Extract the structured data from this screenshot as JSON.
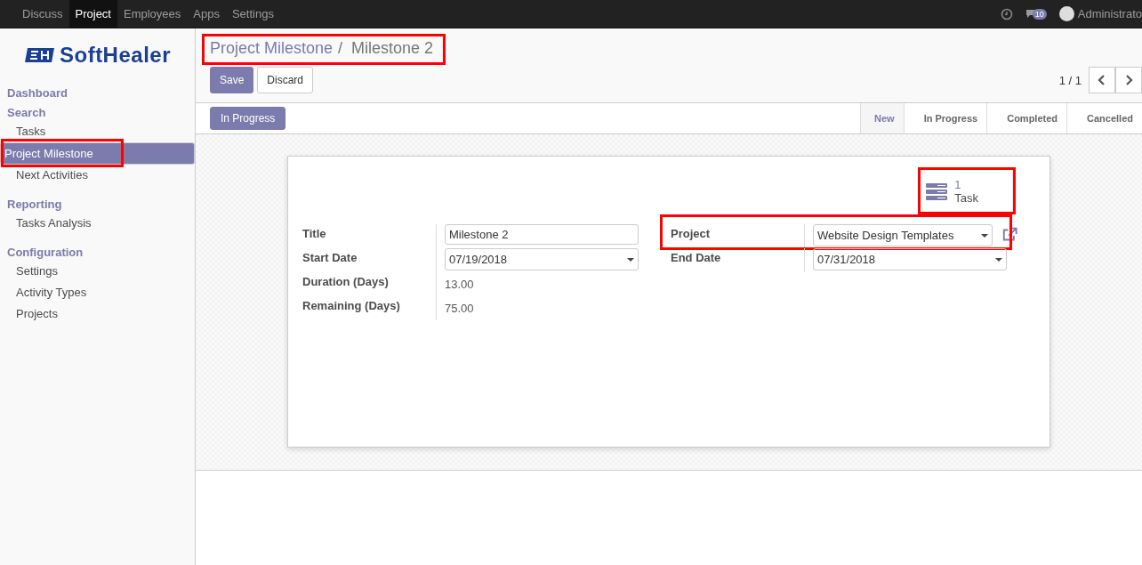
{
  "topbar": {
    "apps": [
      {
        "label": "Discuss",
        "selected": false
      },
      {
        "label": "Project",
        "selected": true
      },
      {
        "label": "Employees",
        "selected": false
      },
      {
        "label": "Apps",
        "selected": false
      },
      {
        "label": "Settings",
        "selected": false
      }
    ],
    "message_count": "10",
    "user": "Administrato"
  },
  "sidebar": {
    "logo": "SoftHealer",
    "sections": [
      {
        "title": "Dashboard"
      },
      {
        "title": "Search",
        "items": [
          {
            "label": "Tasks",
            "selected": false,
            "highlighted": false
          },
          {
            "label": "Project Milestone",
            "selected": true,
            "highlighted": true
          },
          {
            "label": "Next Activities",
            "selected": false,
            "highlighted": false
          }
        ]
      },
      {
        "title": "Reporting",
        "items": [
          {
            "label": "Tasks Analysis",
            "selected": false,
            "highlighted": false
          }
        ]
      },
      {
        "title": "Configuration",
        "items": [
          {
            "label": "Settings",
            "selected": false,
            "highlighted": false
          },
          {
            "label": "Activity Types",
            "selected": false,
            "highlighted": false
          },
          {
            "label": "Projects",
            "selected": false,
            "highlighted": false
          }
        ]
      }
    ]
  },
  "breadcrumb": {
    "parent": "Project Milestone",
    "separator": "/",
    "current": "Milestone 2",
    "highlighted": true
  },
  "buttons": [
    {
      "label": "Save",
      "kind": "primary"
    },
    {
      "label": "Discard",
      "kind": "secondary"
    }
  ],
  "pager": "1 / 1",
  "status_button": "In Progress",
  "stages": [
    {
      "label": "New",
      "selected": true
    },
    {
      "label": "In Progress",
      "selected": false
    },
    {
      "label": "Completed",
      "selected": false
    },
    {
      "label": "Cancelled",
      "selected": false
    }
  ],
  "smart_button": {
    "count": "1",
    "label": "Task",
    "highlighted": true
  },
  "left_fields": [
    {
      "label": "Title",
      "value": "Milestone 2",
      "kind": "text"
    },
    {
      "label": "Start Date",
      "value": "07/19/2018",
      "kind": "select"
    },
    {
      "label": "Duration (Days)",
      "value": "13.00",
      "kind": "readonly"
    },
    {
      "label": "Remaining (Days)",
      "value": "75.00",
      "kind": "readonly"
    }
  ],
  "right_fields": [
    {
      "label": "Project",
      "value": "Website Design Templates",
      "highlighted": true,
      "external_link": true
    },
    {
      "label": "End Date",
      "value": "07/31/2018",
      "highlighted": false,
      "external_link": false
    }
  ]
}
